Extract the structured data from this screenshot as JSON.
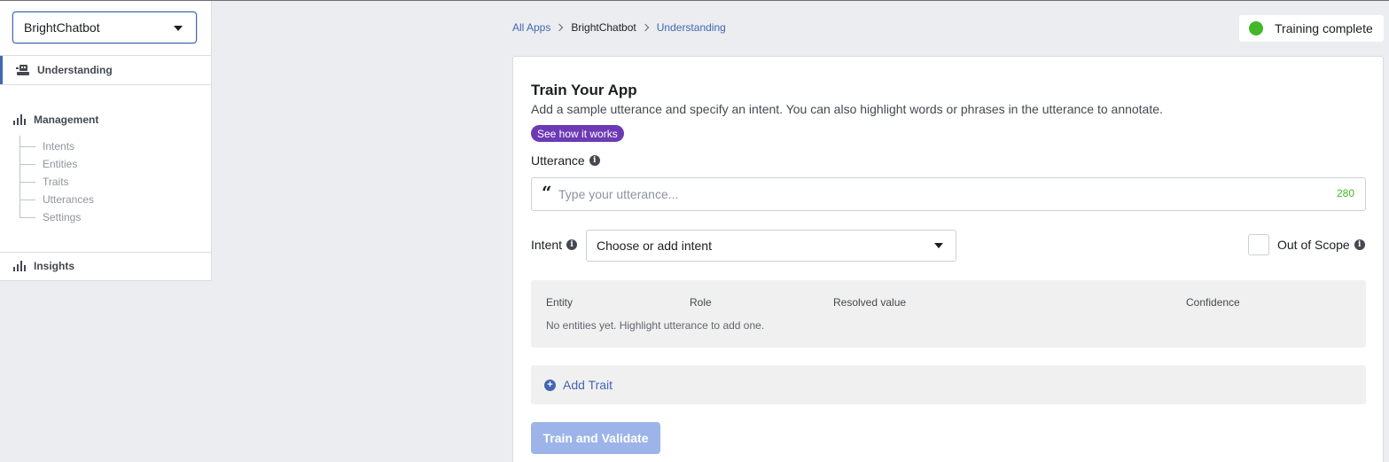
{
  "sidebar": {
    "app_selector": {
      "value": "BrightChatbot",
      "icon": "chevron-down-icon"
    },
    "understanding": {
      "label": "Understanding",
      "icon": "robot-icon",
      "active": true
    },
    "management": {
      "label": "Management",
      "icon": "bar-chart-icon",
      "items": [
        {
          "label": "Intents"
        },
        {
          "label": "Entities"
        },
        {
          "label": "Traits"
        },
        {
          "label": "Utterances"
        },
        {
          "label": "Settings"
        }
      ]
    },
    "insights": {
      "label": "Insights",
      "icon": "bar-chart-icon"
    }
  },
  "breadcrumb": {
    "items": [
      {
        "label": "All Apps"
      },
      {
        "label": "BrightChatbot"
      },
      {
        "label": "Understanding"
      }
    ]
  },
  "status": {
    "label": "Training complete",
    "color": "#42b72a"
  },
  "card": {
    "title": "Train Your App",
    "description": "Add a sample utterance and specify an intent. You can also highlight words or phrases in the utterance to annotate.",
    "how_it_works": "See how it works",
    "utterance": {
      "label": "Utterance",
      "placeholder": "Type your utterance...",
      "char_count": "280",
      "quote_glyph": "“"
    },
    "intent": {
      "label": "Intent",
      "value": "Choose or add intent"
    },
    "out_of_scope": {
      "label": "Out of Scope",
      "checked": false
    },
    "entities": {
      "columns": [
        "Entity",
        "Role",
        "Resolved value",
        "Confidence"
      ],
      "empty_message": "No entities yet. Highlight utterance to add one."
    },
    "add_trait": "Add Trait",
    "train_button": "Train and Validate"
  },
  "colors": {
    "accent": "#4267b2",
    "badge": "#6c3ab5",
    "button_disabled": "#9cb4e9",
    "success": "#42b72a"
  }
}
